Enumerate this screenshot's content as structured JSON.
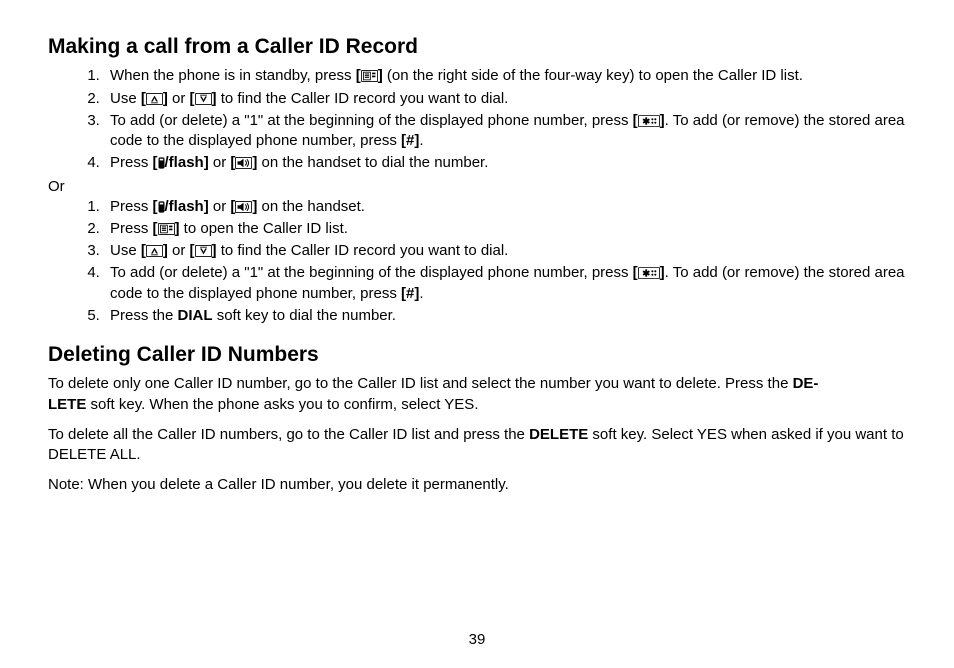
{
  "headings": {
    "making_call": "Making a call from a Caller ID Record",
    "deleting": "Deleting Caller ID Numbers"
  },
  "keys": {
    "flash": "/flash",
    "pound": "#",
    "dial": "DIAL",
    "delete": "DELETE",
    "delete_hyph_a": "DE-",
    "delete_hyph_b": "LETE"
  },
  "listA": {
    "i1_a": "When the phone is in standby, press ",
    "i1_b": " (on the right side of the four-way key) to open the Caller ID list.",
    "i2_a": "Use ",
    "i2_b": " or ",
    "i2_c": " to find the Caller ID record you want to dial.",
    "i3_a": "To add (or delete) a \"1\" at the beginning of the displayed phone number, press ",
    "i3_b": ". To add (or remove) the stored area code to the displayed phone number, press ",
    "i3_c": ".",
    "i4_a": "Press ",
    "i4_b": " or ",
    "i4_c": " on the handset to dial the number.",
    "or": "Or"
  },
  "listB": {
    "i1_a": "Press ",
    "i1_b": " or ",
    "i1_c": " on the handset.",
    "i2_a": "Press ",
    "i2_b": " to open the Caller ID list.",
    "i3_a": "Use ",
    "i3_b": " or ",
    "i3_c": " to find the Caller ID record you want to dial.",
    "i4_a": "To add (or delete) a \"1\" at the beginning of the displayed phone number, press ",
    "i4_b": ". To add (or remove) the stored area code to the displayed phone number, press ",
    "i4_c": ".",
    "i5_a": "Press the ",
    "i5_b": " soft key to dial the number."
  },
  "deleting": {
    "p1_a": "To delete only one Caller ID number, go to the Caller ID list and select the number you want to delete. Press the ",
    "p1_b": " soft key. When the phone asks you to confirm, select YES.",
    "p2_a": "To delete all the Caller ID numbers, go to the Caller ID list and press the ",
    "p2_b": " soft key. Select YES when asked if you want to DELETE ALL.",
    "p3": "Note: When you delete a Caller ID number, you delete it permanently."
  },
  "page_number": "39"
}
